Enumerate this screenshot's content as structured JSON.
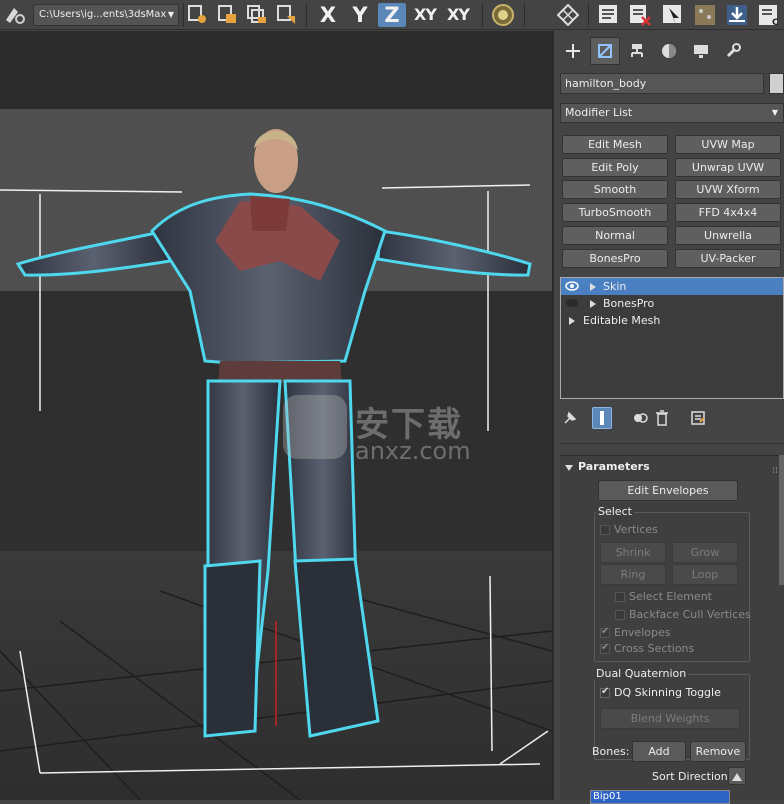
{
  "toolbar": {
    "path_combo": "C:\\Users\\ig...ents\\3dsMax",
    "axis_x": "X",
    "axis_y": "Y",
    "axis_z": "Z",
    "axis_xy": "XY",
    "axis_xy2": "XY"
  },
  "viewport": {
    "watermark_cn": "安下载",
    "watermark_en": "anxz.com"
  },
  "command_panel": {
    "tabs": [
      "create-tab",
      "modify-tab",
      "hierarchy-tab",
      "motion-tab",
      "display-tab",
      "utilities-tab"
    ],
    "object_name": "hamilton_body",
    "object_color": "#d0d0d0",
    "modifier_list": "Modifier List",
    "modifier_buttons": [
      "Edit Mesh",
      "UVW Map",
      "Edit Poly",
      "Unwrap UVW",
      "Smooth",
      "UVW Xform",
      "TurboSmooth",
      "FFD 4x4x4",
      "Normal",
      "Unwrella",
      "BonesPro",
      "UV-Packer"
    ],
    "stack": [
      {
        "label": "Skin",
        "selected": true
      },
      {
        "label": "BonesPro",
        "selected": false
      },
      {
        "label": "Editable Mesh",
        "selected": false
      }
    ]
  },
  "parameters": {
    "title": "Parameters",
    "edit_envelopes": "Edit Envelopes",
    "select_group": "Select",
    "vertices": "Vertices",
    "shrink": "Shrink",
    "grow": "Grow",
    "ring": "Ring",
    "loop": "Loop",
    "select_element": "Select Element",
    "backface_cull": "Backface Cull Vertices",
    "envelopes": "Envelopes",
    "cross_sections": "Cross Sections",
    "dq_group": "Dual Quaternion",
    "dq_toggle": "DQ Skinning Toggle",
    "blend_weights": "Blend Weights",
    "bones_label": "Bones:",
    "add": "Add",
    "remove": "Remove",
    "sort_direction": "Sort Direction:",
    "bone_selected": "Bip01"
  },
  "colors": {
    "selection": "#4a7fc2",
    "accent": "#5a86b8",
    "selection_outline": "#4fd7ee"
  }
}
